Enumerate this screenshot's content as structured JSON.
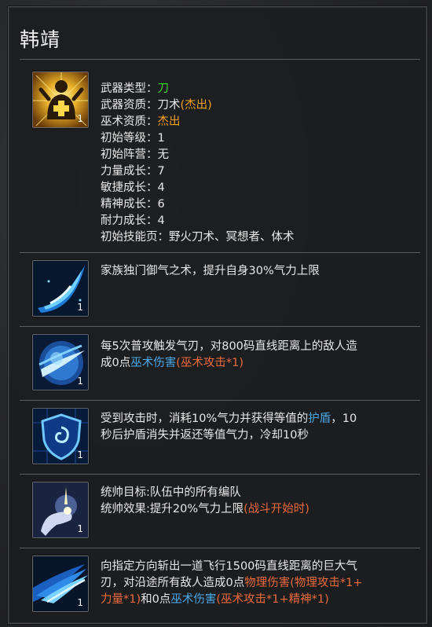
{
  "hero_name": "韩靖",
  "attributes": [
    {
      "label": "武器类型",
      "value": "刀",
      "color": "#3dd630"
    },
    {
      "label": "武器资质",
      "value": "刀术",
      "extra": "(杰出)"
    },
    {
      "label": "巫术资质",
      "value": "杰出",
      "color": "#f0a020"
    },
    {
      "label": "初始等级",
      "value": "1"
    },
    {
      "label": "初始阵营",
      "value": "无"
    },
    {
      "label": "力量成长",
      "value": "7"
    },
    {
      "label": "敏捷成长",
      "value": "4"
    },
    {
      "label": "精神成长",
      "value": "6"
    },
    {
      "label": "耐力成长",
      "value": "4"
    },
    {
      "label": "初始技能页",
      "value": "野火刀术、冥想者、体术"
    }
  ],
  "colon": "：",
  "portrait": {
    "icon": "character-buff-icon",
    "level": "1"
  },
  "skills": [
    {
      "icon": "blue-energy-wave-icon",
      "level": "1",
      "text": [
        [
          {
            "t": "家族独门御气之术，提升自身30%气力上限"
          }
        ]
      ]
    },
    {
      "icon": "blue-orb-blade-icon",
      "level": "1",
      "text": [
        [
          {
            "t": "每5次普攻触发气刃，对800码直线距离上的敌人造"
          }
        ],
        [
          {
            "t": "成0点"
          },
          {
            "t": "巫术伤害",
            "c": "blue"
          },
          {
            "t": "(巫术攻击*1)",
            "c": "red"
          }
        ]
      ]
    },
    {
      "icon": "shield-spiral-icon",
      "level": "1",
      "text": [
        [
          {
            "t": "受到攻击时，消耗10%气力并获得等值的"
          },
          {
            "t": "护盾",
            "c": "blue"
          },
          {
            "t": "，10"
          }
        ],
        [
          {
            "t": "秒后护盾消失并返还等值气力，冷却10秒"
          }
        ]
      ]
    },
    {
      "icon": "glowing-hand-icon",
      "level": "1",
      "text": [
        [
          {
            "t": "统帅目标:队伍中的所有编队"
          }
        ],
        [
          {
            "t": "统帅效果:提升20%气力上限"
          },
          {
            "t": "(战斗开始时)",
            "c": "red"
          }
        ]
      ]
    },
    {
      "icon": "blue-slash-icon",
      "level": "1",
      "text": [
        [
          {
            "t": "向指定方向斩出一道飞行1500码直线距离的巨大气"
          }
        ],
        [
          {
            "t": "刃，对沿途所有敌人造成0点"
          },
          {
            "t": "物理伤害",
            "c": "red"
          },
          {
            "t": "(物理攻击*1+",
            "c": "red"
          }
        ],
        [
          {
            "t": "力量*1)",
            "c": "red"
          },
          {
            "t": "和0点"
          },
          {
            "t": "巫术伤害",
            "c": "blue"
          },
          {
            "t": "(巫术攻击*1+精神*1)",
            "c": "red"
          }
        ]
      ]
    }
  ]
}
